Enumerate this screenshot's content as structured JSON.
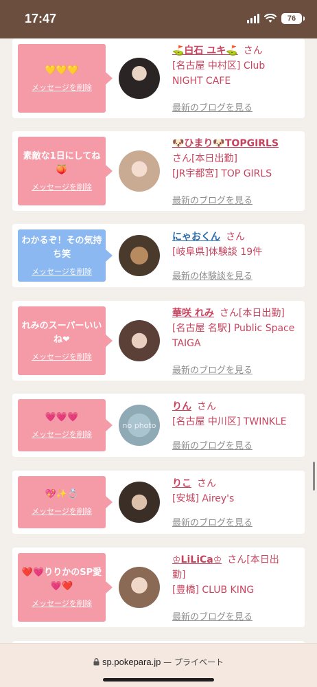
{
  "status": {
    "time": "17:47",
    "battery": "76"
  },
  "browser": {
    "domain": "sp.pokepara.jp",
    "privacy": " — プライベート"
  },
  "cards": [
    {
      "message": "💛💛💛",
      "delete_label": "メッセージを削除",
      "name": "⛳白石 ユキ⛳",
      "suffix": "さん",
      "line1": "[名古屋 中村区] Club",
      "line2": "NIGHT CAFE",
      "link": "最新のブログを見る"
    },
    {
      "message": "素敵な1日にしてね🍑",
      "delete_label": "メッセージを削除",
      "name": "🐶ひまり🐶TOPGIRLS",
      "line1": "さん[本日出勤]",
      "line2": "[JR宇都宮] TOP GIRLS",
      "link": "最新のブログを見る"
    },
    {
      "message": "わかるぞ！その気持ち笑",
      "delete_label": "メッセージを削除",
      "name": "にゃおくん",
      "suffix": "さん",
      "line1": "[岐阜県]体験談 19件",
      "link": "最新の体験談を見る"
    },
    {
      "message": "れみのスーパーいいね❤︎",
      "delete_label": "メッセージを削除",
      "name": "華咲 れみ",
      "suffix": "さん[本日出勤]",
      "line1": "[名古屋 名駅] Public Space",
      "line2": "TAIGA",
      "link": "最新のブログを見る"
    },
    {
      "message": "💗💗💗",
      "delete_label": "メッセージを削除",
      "name": "りん",
      "suffix": "さん",
      "line1": "[名古屋 中川区] TWINKLE",
      "link": "最新のブログを見る",
      "avatar_text": "no photo"
    },
    {
      "message": "💖✨💍",
      "delete_label": "メッセージを削除",
      "name": "りこ",
      "suffix": "さん",
      "line1": "[安城] Airey's",
      "link": "最新のブログを見る"
    },
    {
      "message": "❤️💗りりかのSP愛💗❤️",
      "delete_label": "メッセージを削除",
      "name": "♔LiLiCa♔",
      "suffix": "さん[本日出",
      "line1": "勤]",
      "line2": "[豊橋] CLUB KING",
      "link": "最新のブログを見る"
    }
  ],
  "colors": {
    "accent": "#c8435e",
    "bubble_pink": "#f59aa7",
    "bubble_blue": "#8bb8f0",
    "header": "#6b4e3d"
  }
}
